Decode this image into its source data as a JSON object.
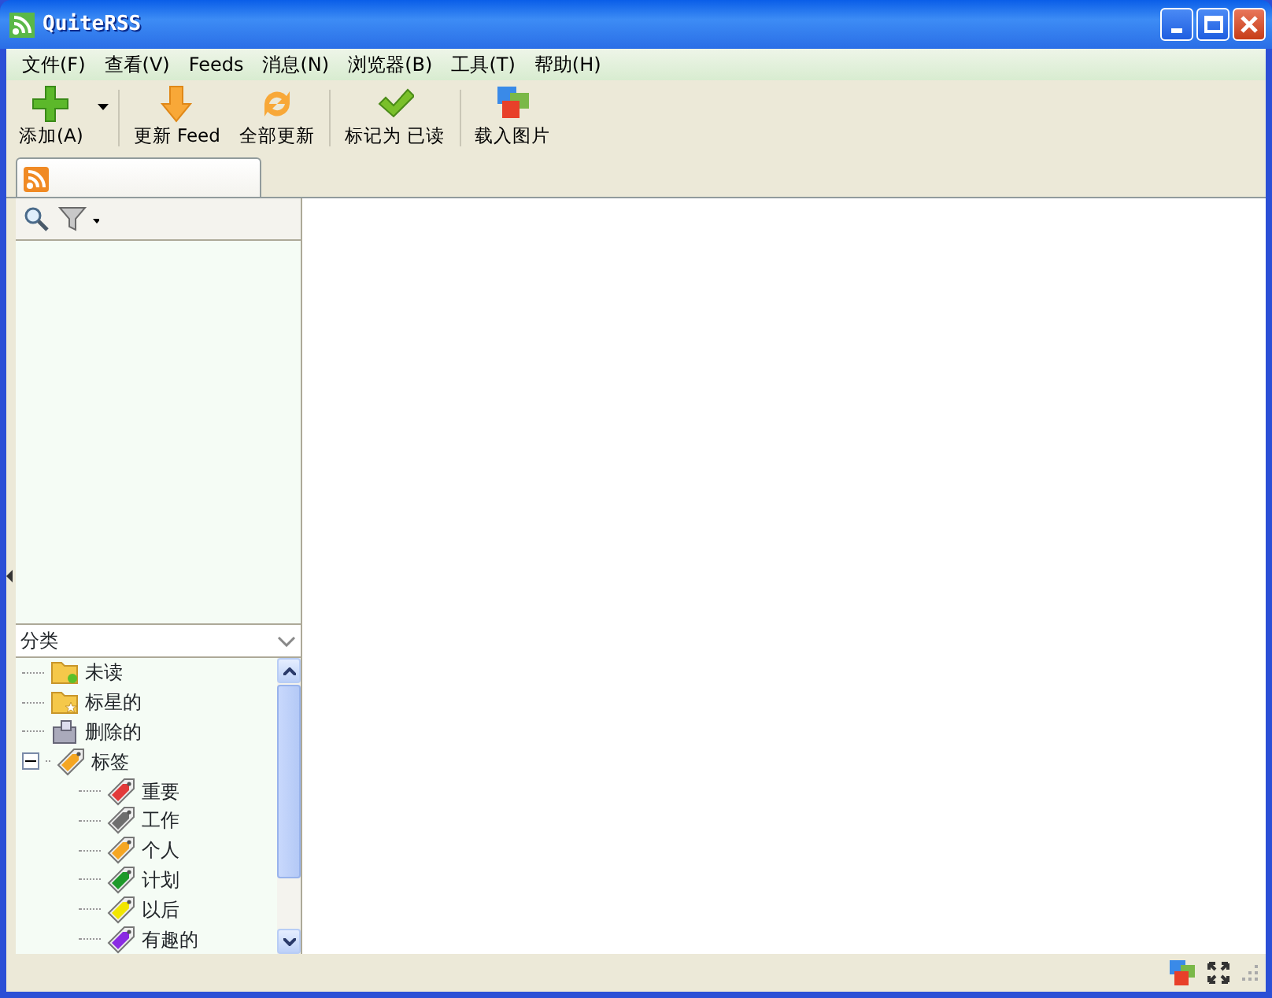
{
  "window": {
    "title": "QuiteRSS"
  },
  "menu": [
    "文件(F)",
    "查看(V)",
    "Feeds",
    "消息(N)",
    "浏览器(B)",
    "工具(T)",
    "帮助(H)"
  ],
  "toolbar": [
    {
      "kind": "add",
      "label": "添加(A)"
    },
    {
      "kind": "menu-caret"
    },
    {
      "kind": "update",
      "label": "更新 Feed"
    },
    {
      "kind": "update-all",
      "label": "全部更新"
    },
    {
      "kind": "mark-read",
      "label": "标记为 已读"
    },
    {
      "kind": "images",
      "label": "载入图片"
    }
  ],
  "tabs": [
    {
      "kind": "feeds",
      "selected": true
    }
  ],
  "categories": {
    "title": "分类",
    "items": [
      {
        "kind": "unread",
        "label": "未读"
      },
      {
        "kind": "starred",
        "label": "标星的"
      },
      {
        "kind": "deleted",
        "label": "删除的"
      },
      {
        "kind": "tag",
        "label": "标签",
        "expanded": true,
        "color": "#f5a623",
        "children": [
          {
            "kind": "tag",
            "label": "重要",
            "color": "#e23a3a"
          },
          {
            "kind": "tag",
            "label": "工作",
            "color": "#6e6e6e"
          },
          {
            "kind": "tag",
            "label": "个人",
            "color": "#f5a623"
          },
          {
            "kind": "tag",
            "label": "计划",
            "color": "#1e9a2a"
          },
          {
            "kind": "tag",
            "label": "以后",
            "color": "#f2e600"
          },
          {
            "kind": "tag",
            "label": "有趣的",
            "color": "#8a2be2"
          }
        ]
      }
    ]
  }
}
